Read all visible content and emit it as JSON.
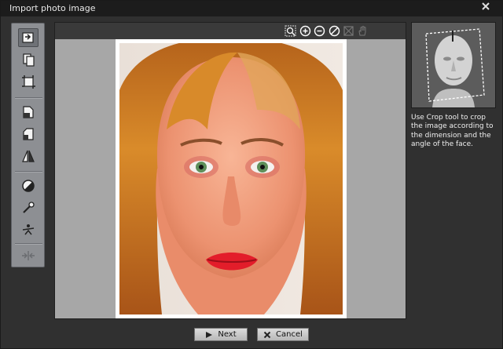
{
  "window": {
    "title": "Import photo image"
  },
  "toolbar": {
    "tools": [
      {
        "icon": "import-photo-icon"
      },
      {
        "icon": "paste-photo-icon"
      },
      {
        "icon": "crop-icon"
      },
      {
        "icon": "rotate-left-icon"
      },
      {
        "icon": "rotate-right-icon"
      },
      {
        "icon": "flip-icon"
      },
      {
        "icon": "contrast-icon"
      },
      {
        "icon": "eyedropper-icon"
      },
      {
        "icon": "level-balance-icon"
      },
      {
        "icon": "compare-icon"
      }
    ]
  },
  "viewer": {
    "tools": [
      "zoom-fit-icon",
      "zoom-in-icon",
      "zoom-out-icon",
      "zoom-reset-icon",
      "fit-window-icon",
      "hand-pan-icon"
    ]
  },
  "hint": {
    "text": "Use Crop tool to crop the image according to the dimension and the angle of the face."
  },
  "buttons": {
    "next_label": "Next",
    "cancel_label": "Cancel"
  },
  "colors": {
    "window_bg": "#303030",
    "titlebar_bg": "#1c1c1c",
    "toolbar_bg": "#8d8f93",
    "viewer_bg": "#a7a7a7"
  }
}
